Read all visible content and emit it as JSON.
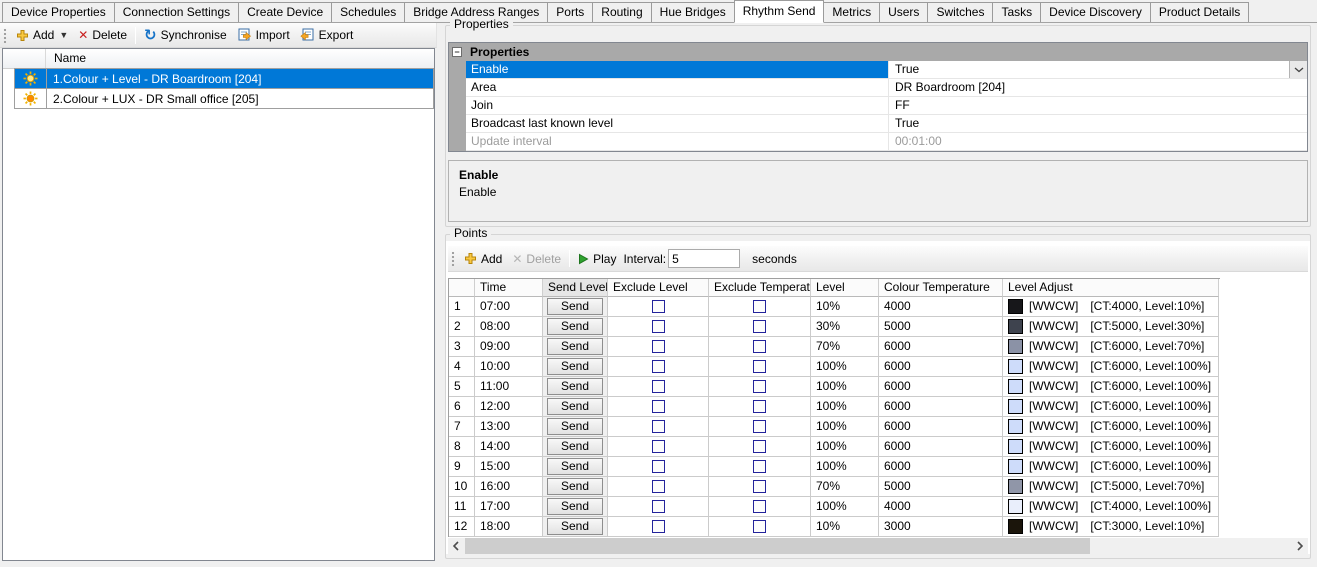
{
  "window": {
    "background": "#f0f0f0",
    "accent": "#0078d7"
  },
  "tabs": {
    "active_index": 8,
    "items": [
      "Device Properties",
      "Connection Settings",
      "Create Device",
      "Schedules",
      "Bridge Address Ranges",
      "Ports",
      "Routing",
      "Hue Bridges",
      "Rhythm Send",
      "Metrics",
      "Users",
      "Switches",
      "Tasks",
      "Device Discovery",
      "Product Details"
    ]
  },
  "left_panel": {
    "toolbar": {
      "add_label": "Add",
      "delete_label": "Delete",
      "synchronise_label": "Synchronise",
      "import_label": "Import",
      "export_label": "Export"
    },
    "list": {
      "name_header": "Name",
      "rows": [
        {
          "label": "1.Colour + Level - DR Boardroom [204]",
          "selected": true,
          "icon": "sun-icon",
          "icon_center": "#ffe98a"
        },
        {
          "label": "2.Colour + LUX - DR Small office [205]",
          "selected": false,
          "icon": "sun-icon",
          "icon_center": "#ff8a00"
        }
      ]
    }
  },
  "properties_panel": {
    "group_label": "Properties",
    "grid": {
      "category_label": "Properties",
      "rows": [
        {
          "name": "Enable",
          "value": "True",
          "selected": true,
          "dropdown": true
        },
        {
          "name": "Area",
          "value": "DR Boardroom [204]"
        },
        {
          "name": "Join",
          "value": "FF"
        },
        {
          "name": "Broadcast last known level",
          "value": "True"
        },
        {
          "name": "Update interval",
          "value": "00:01:00",
          "disabled": true
        }
      ]
    },
    "description": {
      "title": "Enable",
      "body": "Enable"
    }
  },
  "points_panel": {
    "group_label": "Points",
    "toolbar": {
      "add_label": "Add",
      "delete_label": "Delete",
      "delete_disabled": true,
      "play_label": "Play",
      "interval_label": "Interval:",
      "interval_value": "5",
      "units_label": "seconds"
    },
    "table": {
      "columns": [
        "",
        "Time",
        "Send Level",
        "Exclude Level",
        "Exclude Temperature",
        "Level",
        "Colour Temperature",
        "Level Adjust"
      ],
      "send_button_label": "Send",
      "rows": [
        {
          "num": "1",
          "time": "07:00",
          "exclude_level": false,
          "exclude_temperature": false,
          "level": "10%",
          "colour_temperature": "4000",
          "swatch": "#17171a",
          "adjust_tag": "[WWCW]",
          "adjust_detail": "[CT:4000, Level:10%]"
        },
        {
          "num": "2",
          "time": "08:00",
          "exclude_level": false,
          "exclude_temperature": false,
          "level": "30%",
          "colour_temperature": "5000",
          "swatch": "#3e434e",
          "adjust_tag": "[WWCW]",
          "adjust_detail": "[CT:5000, Level:30%]"
        },
        {
          "num": "3",
          "time": "09:00",
          "exclude_level": false,
          "exclude_temperature": false,
          "level": "70%",
          "colour_temperature": "6000",
          "swatch": "#8b92a6",
          "adjust_tag": "[WWCW]",
          "adjust_detail": "[CT:6000, Level:70%]"
        },
        {
          "num": "4",
          "time": "10:00",
          "exclude_level": false,
          "exclude_temperature": false,
          "level": "100%",
          "colour_temperature": "6000",
          "swatch": "#cedcfa",
          "adjust_tag": "[WWCW]",
          "adjust_detail": "[CT:6000, Level:100%]"
        },
        {
          "num": "5",
          "time": "11:00",
          "exclude_level": false,
          "exclude_temperature": false,
          "level": "100%",
          "colour_temperature": "6000",
          "swatch": "#cedcfa",
          "adjust_tag": "[WWCW]",
          "adjust_detail": "[CT:6000, Level:100%]"
        },
        {
          "num": "6",
          "time": "12:00",
          "exclude_level": false,
          "exclude_temperature": false,
          "level": "100%",
          "colour_temperature": "6000",
          "swatch": "#cedcfa",
          "adjust_tag": "[WWCW]",
          "adjust_detail": "[CT:6000, Level:100%]"
        },
        {
          "num": "7",
          "time": "13:00",
          "exclude_level": false,
          "exclude_temperature": false,
          "level": "100%",
          "colour_temperature": "6000",
          "swatch": "#cedcfa",
          "adjust_tag": "[WWCW]",
          "adjust_detail": "[CT:6000, Level:100%]"
        },
        {
          "num": "8",
          "time": "14:00",
          "exclude_level": false,
          "exclude_temperature": false,
          "level": "100%",
          "colour_temperature": "6000",
          "swatch": "#cedcfa",
          "adjust_tag": "[WWCW]",
          "adjust_detail": "[CT:6000, Level:100%]"
        },
        {
          "num": "9",
          "time": "15:00",
          "exclude_level": false,
          "exclude_temperature": false,
          "level": "100%",
          "colour_temperature": "6000",
          "swatch": "#cedcfa",
          "adjust_tag": "[WWCW]",
          "adjust_detail": "[CT:6000, Level:100%]"
        },
        {
          "num": "10",
          "time": "16:00",
          "exclude_level": false,
          "exclude_temperature": false,
          "level": "70%",
          "colour_temperature": "5000",
          "swatch": "#9096a8",
          "adjust_tag": "[WWCW]",
          "adjust_detail": "[CT:5000, Level:70%]"
        },
        {
          "num": "11",
          "time": "17:00",
          "exclude_level": false,
          "exclude_temperature": false,
          "level": "100%",
          "colour_temperature": "4000",
          "swatch": "#e9eefb",
          "adjust_tag": "[WWCW]",
          "adjust_detail": "[CT:4000, Level:100%]"
        },
        {
          "num": "12",
          "time": "18:00",
          "exclude_level": false,
          "exclude_temperature": false,
          "level": "10%",
          "colour_temperature": "3000",
          "swatch": "#1b150b",
          "adjust_tag": "[WWCW]",
          "adjust_detail": "[CT:3000, Level:10%]"
        }
      ]
    },
    "hscrollbar": {
      "thumb_fraction": 0.755
    }
  }
}
